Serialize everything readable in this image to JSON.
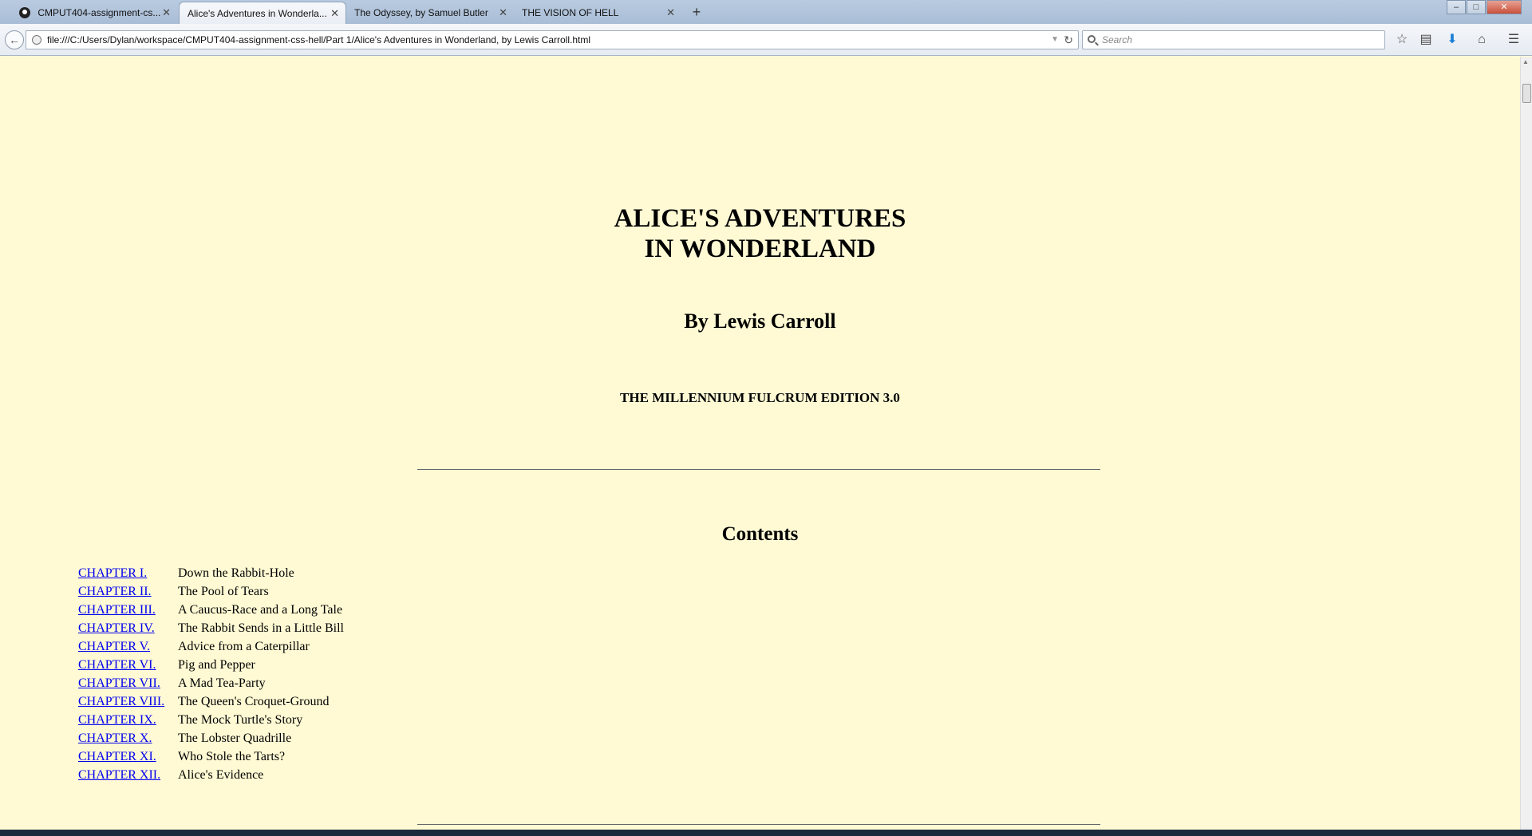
{
  "tabs": [
    {
      "label": "CMPUT404-assignment-cs...",
      "close": "✕"
    },
    {
      "label": "Alice's Adventures in Wonderla...",
      "close": "✕"
    },
    {
      "label": "The Odyssey, by Samuel Butler",
      "close": "✕"
    },
    {
      "label": "THE VISION OF HELL",
      "close": "✕"
    }
  ],
  "new_tab": "+",
  "window_controls": {
    "minimize": "–",
    "maximize": "□",
    "close": "✕"
  },
  "navbar": {
    "url": "file:///C:/Users/Dylan/workspace/CMPUT404-assignment-css-hell/Part 1/Alice's Adventures in Wonderland, by Lewis Carroll.html",
    "search_placeholder": "Search"
  },
  "icons": {
    "back": "back-arrow-icon",
    "reload": "reload-icon",
    "bookmark": "star-icon",
    "reading_list": "clipboard-icon",
    "downloads": "download-arrow-icon",
    "home": "home-icon",
    "menu": "hamburger-menu-icon"
  },
  "book": {
    "title_line1": "ALICE'S ADVENTURES",
    "title_line2": "IN WONDERLAND",
    "author": "By Lewis Carroll",
    "edition": "THE MILLENNIUM FULCRUM EDITION 3.0",
    "contents_heading": "Contents",
    "chapters": [
      {
        "link": "CHAPTER I.",
        "name": "Down the Rabbit-Hole"
      },
      {
        "link": "CHAPTER II.",
        "name": "The Pool of Tears"
      },
      {
        "link": "CHAPTER III.",
        "name": "A Caucus-Race and a Long Tale"
      },
      {
        "link": "CHAPTER IV.",
        "name": "The Rabbit Sends in a Little Bill"
      },
      {
        "link": "CHAPTER V.",
        "name": "Advice from a Caterpillar"
      },
      {
        "link": "CHAPTER VI.",
        "name": "Pig and Pepper"
      },
      {
        "link": "CHAPTER VII.",
        "name": "A Mad Tea-Party"
      },
      {
        "link": "CHAPTER VIII.",
        "name": "The Queen's Croquet-Ground"
      },
      {
        "link": "CHAPTER IX.",
        "name": "The Mock Turtle's Story"
      },
      {
        "link": "CHAPTER X.",
        "name": "The Lobster Quadrille"
      },
      {
        "link": "CHAPTER XI.",
        "name": "Who Stole the Tarts?"
      },
      {
        "link": "CHAPTER XII.",
        "name": "Alice's Evidence"
      }
    ]
  },
  "colors": {
    "page_background": "#fffad4",
    "link": "#0000ee"
  }
}
